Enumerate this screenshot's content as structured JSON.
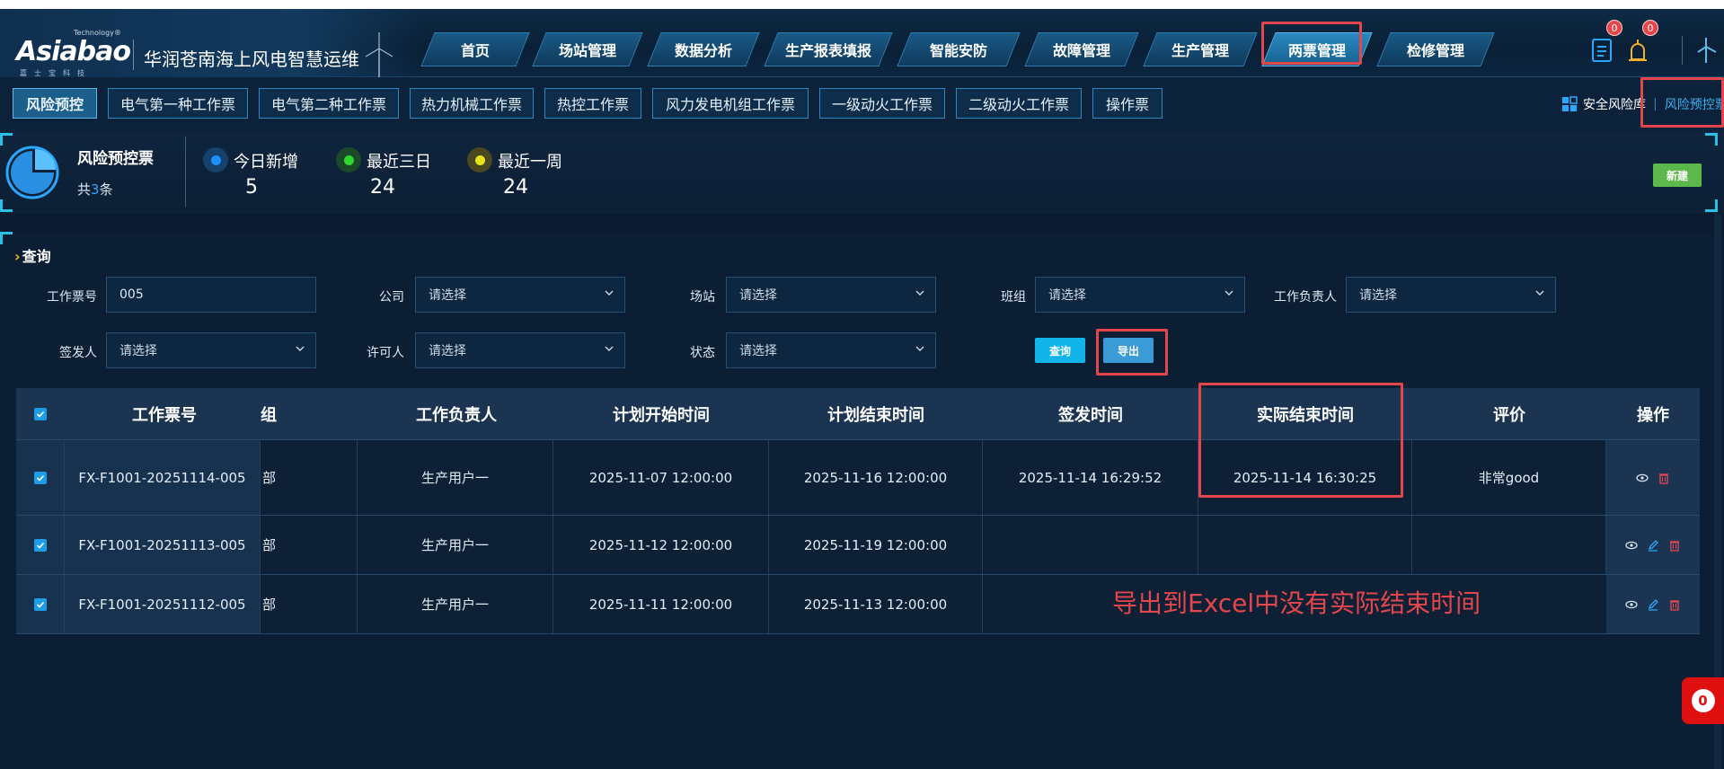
{
  "header": {
    "logo_text": "Asiabao",
    "logo_tech": "Technology®",
    "logo_sub": "嘉士宝科技",
    "app_title": "华润苍南海上风电智慧运维",
    "nav": [
      "首页",
      "场站管理",
      "数据分析",
      "生产报表填报",
      "智能安防",
      "故障管理",
      "生产管理",
      "两票管理",
      "检修管理"
    ],
    "active_nav": "两票管理",
    "badges": [
      "0",
      "0"
    ]
  },
  "subtabs": {
    "items": [
      "风险预控",
      "电气第一种工作票",
      "电气第二种工作票",
      "热力机械工作票",
      "热控工作票",
      "风力发电机组工作票",
      "一级动火工作票",
      "二级动火工作票",
      "操作票"
    ],
    "active": "风险预控",
    "right_link_1": "安全风险库",
    "right_link_2": "风险预控票"
  },
  "stats": {
    "title": "风险预控票",
    "total_prefix": "共",
    "total_num": "3",
    "total_suffix": "条",
    "items": [
      {
        "label": "今日新增",
        "value": "5",
        "color": "#1e8fff"
      },
      {
        "label": "最近三日",
        "value": "24",
        "color": "#2fd62f"
      },
      {
        "label": "最近一周",
        "value": "24",
        "color": "#e8e21a"
      }
    ],
    "new_button": "新建"
  },
  "query": {
    "title": "查询",
    "fields": {
      "ticket_no": {
        "label": "工作票号",
        "value": "005"
      },
      "company": {
        "label": "公司",
        "value": "请选择"
      },
      "station": {
        "label": "场站",
        "value": "请选择"
      },
      "team": {
        "label": "班组",
        "value": "请选择"
      },
      "leader": {
        "label": "工作负责人",
        "value": "请选择"
      },
      "issuer": {
        "label": "签发人",
        "value": "请选择"
      },
      "permitter": {
        "label": "许可人",
        "value": "请选择"
      },
      "status": {
        "label": "状态",
        "value": "请选择"
      }
    },
    "search_button": "查询",
    "export_button": "导出"
  },
  "table": {
    "columns": [
      "工作票号",
      "组",
      "工作负责人",
      "计划开始时间",
      "计划结束时间",
      "签发时间",
      "实际结束时间",
      "评价",
      "操作"
    ],
    "rows": [
      {
        "ticket_no": "FX-F1001-20251114-005",
        "team": "部",
        "leader": "生产用户一",
        "plan_start": "2025-11-07 12:00:00",
        "plan_end": "2025-11-16 12:00:00",
        "issue_time": "2025-11-14 16:29:52",
        "actual_end": "2025-11-14 16:30:25",
        "rating": "非常good"
      },
      {
        "ticket_no": "FX-F1001-20251113-005",
        "team": "部",
        "leader": "生产用户一",
        "plan_start": "2025-11-12 12:00:00",
        "plan_end": "2025-11-19 12:00:00",
        "issue_time": "",
        "actual_end": "",
        "rating": ""
      },
      {
        "ticket_no": "FX-F1001-20251112-005",
        "team": "部",
        "leader": "生产用户一",
        "plan_start": "2025-11-11 12:00:00",
        "plan_end": "2025-11-13 12:00:00",
        "issue_time": "",
        "actual_end": "",
        "rating": ""
      }
    ]
  },
  "annotation": "导出到Excel中没有实际结束时间",
  "float_badge": "0",
  "colors": {
    "accent": "#2aa8ff",
    "highlight": "#e5464b",
    "new_btn": "#5cb84a"
  }
}
